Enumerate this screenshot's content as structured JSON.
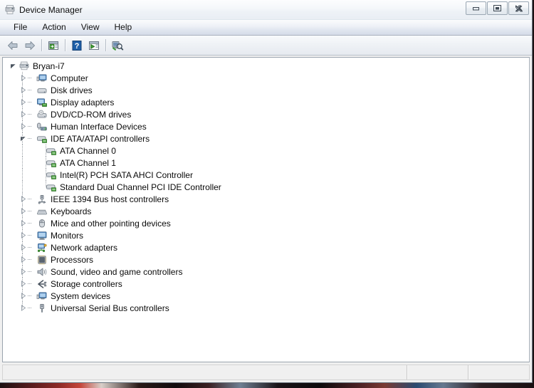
{
  "window": {
    "title": "Device Manager",
    "title_icon": "device-manager-icon",
    "buttons": {
      "minimize": "Minimize",
      "maximize": "Maximize",
      "close": "Close"
    }
  },
  "menubar": {
    "items": [
      {
        "label": "File"
      },
      {
        "label": "Action"
      },
      {
        "label": "View"
      },
      {
        "label": "Help"
      }
    ]
  },
  "toolbar": {
    "items": [
      {
        "name": "back-arrow-icon",
        "tooltip": "Back"
      },
      {
        "name": "forward-arrow-icon",
        "tooltip": "Forward"
      },
      {
        "name": "separator"
      },
      {
        "name": "properties-icon",
        "tooltip": "Properties"
      },
      {
        "name": "separator"
      },
      {
        "name": "help-icon",
        "tooltip": "Help"
      },
      {
        "name": "update-driver-icon",
        "tooltip": "Update Driver Software"
      },
      {
        "name": "separator"
      },
      {
        "name": "scan-hardware-changes-icon",
        "tooltip": "Scan for hardware changes"
      }
    ]
  },
  "tree": {
    "root": {
      "label": "Bryan-i7",
      "icon": "computer-node-icon",
      "expanded": true
    },
    "nodes": [
      {
        "label": "Computer",
        "icon": "computer-icon",
        "expanded": false,
        "depth": 1
      },
      {
        "label": "Disk drives",
        "icon": "disk-drive-icon",
        "expanded": false,
        "depth": 1
      },
      {
        "label": "Display adapters",
        "icon": "display-adapter-icon",
        "expanded": false,
        "depth": 1
      },
      {
        "label": "DVD/CD-ROM drives",
        "icon": "dvd-drive-icon",
        "expanded": false,
        "depth": 1
      },
      {
        "label": "Human Interface Devices",
        "icon": "hid-icon",
        "expanded": false,
        "depth": 1
      },
      {
        "label": "IDE ATA/ATAPI controllers",
        "icon": "ide-controller-icon",
        "expanded": true,
        "depth": 1
      },
      {
        "label": "ATA Channel 0",
        "icon": "ata-channel-icon",
        "depth": 2,
        "leaf": true
      },
      {
        "label": "ATA Channel 1",
        "icon": "ata-channel-icon",
        "depth": 2,
        "leaf": true
      },
      {
        "label": "Intel(R) PCH SATA AHCI Controller",
        "icon": "ata-channel-icon",
        "depth": 2,
        "leaf": true
      },
      {
        "label": "Standard Dual Channel PCI IDE Controller",
        "icon": "ata-channel-icon",
        "depth": 2,
        "leaf": true,
        "last": true
      },
      {
        "label": "IEEE 1394 Bus host controllers",
        "icon": "ieee1394-icon",
        "expanded": false,
        "depth": 1
      },
      {
        "label": "Keyboards",
        "icon": "keyboard-icon",
        "expanded": false,
        "depth": 1
      },
      {
        "label": "Mice and other pointing devices",
        "icon": "mouse-icon",
        "expanded": false,
        "depth": 1
      },
      {
        "label": "Monitors",
        "icon": "monitor-icon",
        "expanded": false,
        "depth": 1
      },
      {
        "label": "Network adapters",
        "icon": "network-adapter-icon",
        "expanded": false,
        "depth": 1
      },
      {
        "label": "Processors",
        "icon": "processor-icon",
        "expanded": false,
        "depth": 1
      },
      {
        "label": "Sound, video and game controllers",
        "icon": "sound-icon",
        "expanded": false,
        "depth": 1
      },
      {
        "label": "Storage controllers",
        "icon": "storage-controller-icon",
        "expanded": false,
        "depth": 1
      },
      {
        "label": "System devices",
        "icon": "system-device-icon",
        "expanded": false,
        "depth": 1
      },
      {
        "label": "Universal Serial Bus controllers",
        "icon": "usb-controller-icon",
        "expanded": false,
        "depth": 1
      }
    ]
  },
  "statusbar": {
    "main": "",
    "segment1": "",
    "segment2": ""
  },
  "colors": {
    "titlebar": "#f4f7fa",
    "menubar": "#dde3ee",
    "panel": "#ffffff",
    "statusbar": "#f0f0f0",
    "text": "#0a0a0a",
    "icon_green": "#3f9b35",
    "icon_blue": "#1f5fa8"
  }
}
